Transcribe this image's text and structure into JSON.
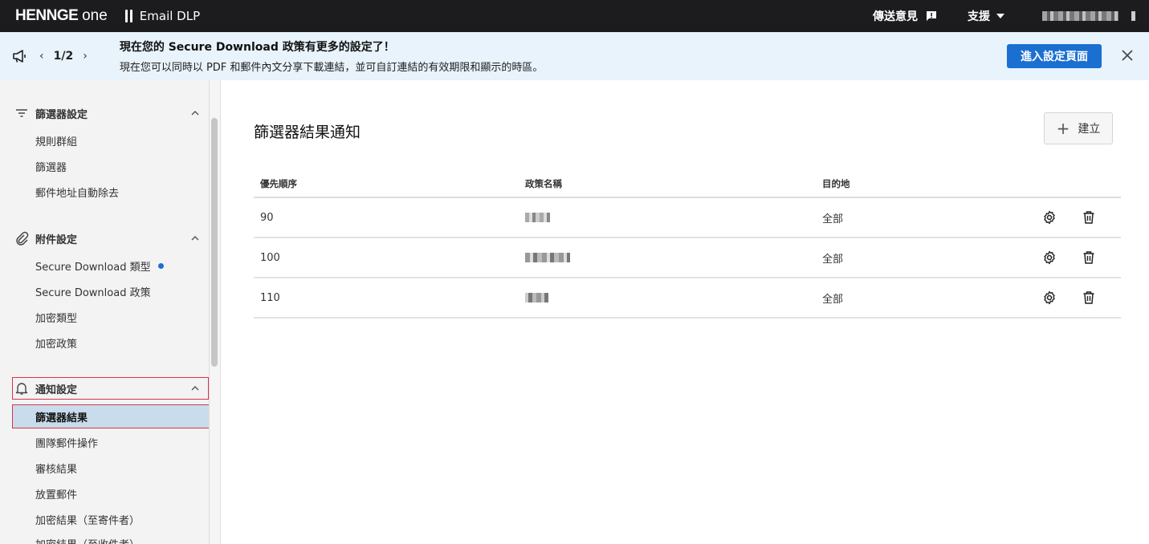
{
  "topbar": {
    "brand_main": "HENNGE",
    "brand_one": "one",
    "product": "Email DLP",
    "feedback_label": "傳送意見",
    "support_label": "支援"
  },
  "banner": {
    "pager": "1/2",
    "title": "現在您的 Secure Download 政策有更多的設定了！",
    "description": "現在您可以同時以 PDF 和郵件內文分享下載連結，並可自訂連結的有效期限和顯示的時區。",
    "button_label": "進入設定頁面"
  },
  "sidebar": {
    "sections": [
      {
        "label": "篩選器設定",
        "icon": "filter-icon",
        "items": [
          "規則群組",
          "篩選器",
          "郵件地址自動除去"
        ]
      },
      {
        "label": "附件設定",
        "icon": "paperclip-icon",
        "items": [
          "Secure Download 類型",
          "Secure Download 政策",
          "加密類型",
          "加密政策"
        ]
      },
      {
        "label": "通知設定",
        "icon": "bell-icon",
        "items": [
          "篩選器結果",
          "團隊郵件操作",
          "審核結果",
          "放置郵件",
          "加密結果（至寄件者）",
          "加密結果（至收件者）"
        ]
      }
    ],
    "active_item": "篩選器結果"
  },
  "main": {
    "title": "篩選器結果通知",
    "create_label": "建立",
    "columns": [
      "優先順序",
      "政策名稱",
      "目的地"
    ],
    "rows": [
      {
        "priority": "90",
        "destination": "全部"
      },
      {
        "priority": "100",
        "destination": "全部"
      },
      {
        "priority": "110",
        "destination": "全部"
      }
    ]
  },
  "colors": {
    "topbar": "#1c1c1e",
    "banner": "#e8f3fb",
    "accent": "#1a6fd1",
    "active_item_bg": "#c9dcec",
    "highlight_border": "#d9324a"
  }
}
